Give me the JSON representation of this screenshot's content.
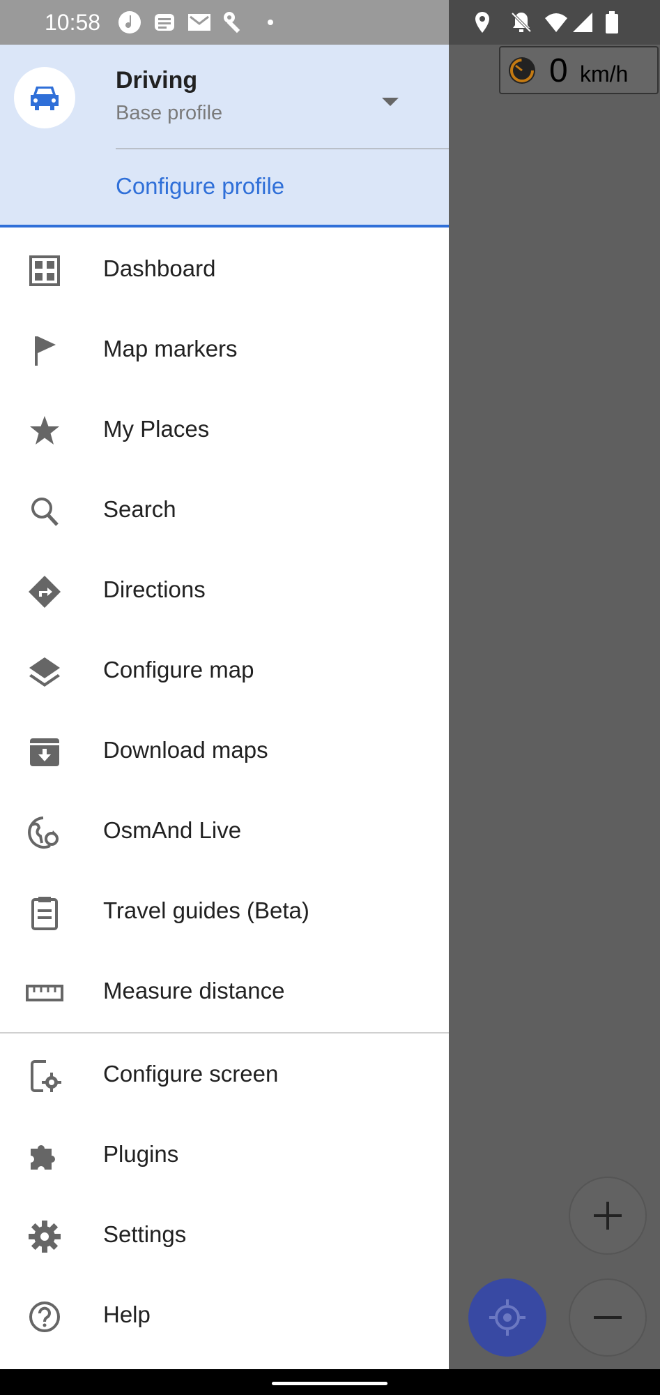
{
  "status_bar": {
    "time": "10:58"
  },
  "profile": {
    "name": "Driving",
    "subtitle": "Base profile",
    "configure_label": "Configure profile",
    "accent_color": "#2f6fd8"
  },
  "menu": [
    {
      "label": "Dashboard",
      "icon": "dashboard-icon"
    },
    {
      "label": "Map markers",
      "icon": "flag-icon"
    },
    {
      "label": "My Places",
      "icon": "star-icon"
    },
    {
      "label": "Search",
      "icon": "search-icon"
    },
    {
      "label": "Directions",
      "icon": "directions-icon"
    },
    {
      "label": "Configure map",
      "icon": "layers-icon"
    },
    {
      "label": "Download maps",
      "icon": "archive-download-icon"
    },
    {
      "label": "OsmAnd Live",
      "icon": "globe-refresh-icon"
    },
    {
      "label": "Travel guides (Beta)",
      "icon": "clipboard-icon"
    },
    {
      "label": "Measure distance",
      "icon": "ruler-icon"
    },
    {
      "label": "Configure screen",
      "icon": "screen-settings-icon"
    },
    {
      "label": "Plugins",
      "icon": "puzzle-icon"
    },
    {
      "label": "Settings",
      "icon": "gear-icon"
    },
    {
      "label": "Help",
      "icon": "help-icon"
    }
  ],
  "map": {
    "speed_value": "0",
    "speed_unit": "km/h"
  }
}
